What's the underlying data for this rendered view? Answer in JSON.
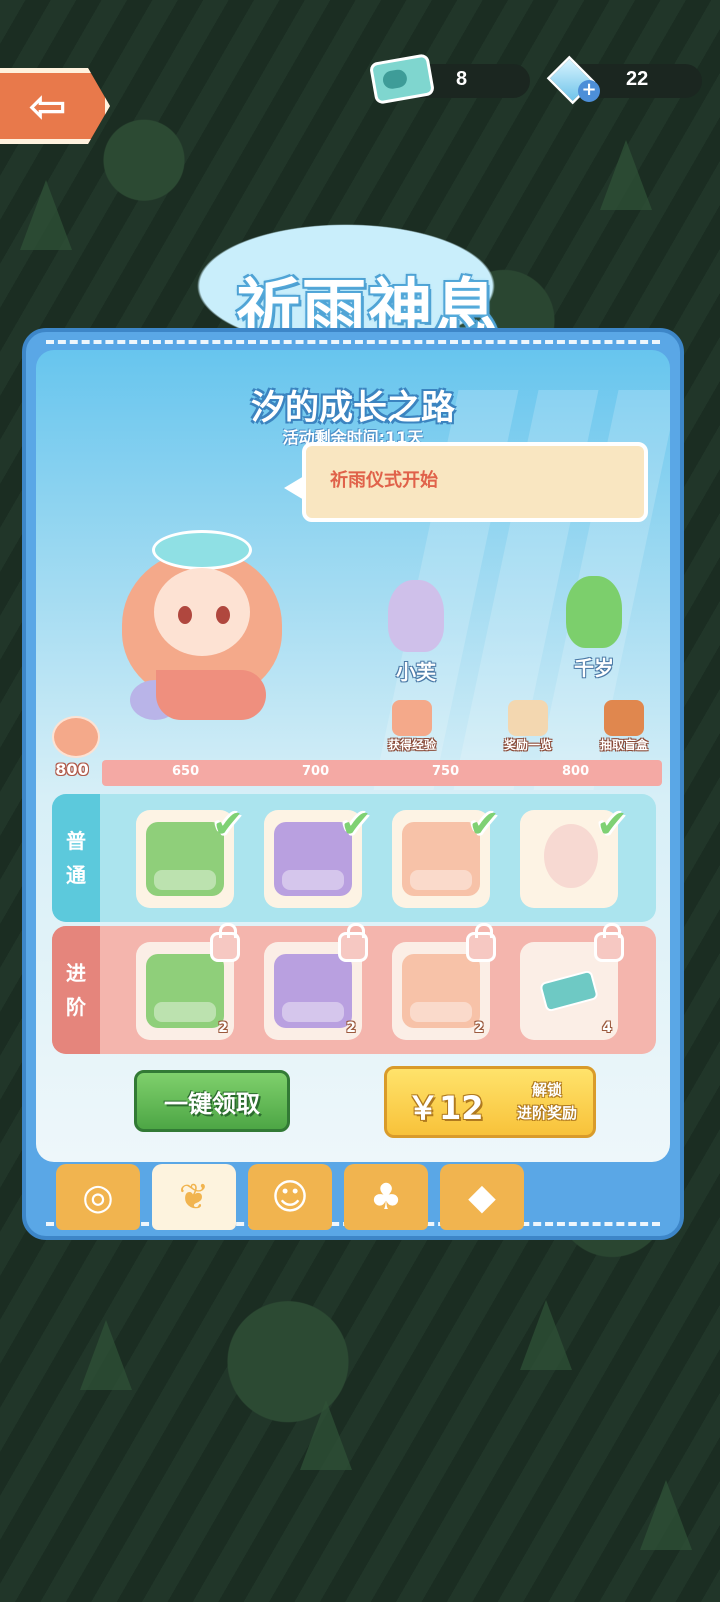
{
  "topbar": {
    "tickets": "8",
    "diamonds": "22"
  },
  "logo": {
    "title": "祈雨神息"
  },
  "panel": {
    "subtitle": "汐的成长之路",
    "time_left": "活动剩余时间:11天",
    "bubble_text": "祈雨仪式开始"
  },
  "characters": [
    {
      "name": "小芙",
      "color": "#cfc0ea"
    },
    {
      "name": "千岁",
      "color": "#7ccf6c"
    }
  ],
  "actions": [
    {
      "label": "获得经验",
      "icon": "exp-up-icon",
      "color": "#f4a98a"
    },
    {
      "label": "奖励一览",
      "icon": "reward-list-icon",
      "color": "#f3d7b0"
    },
    {
      "label": "抽取盲盒",
      "icon": "blind-box-icon",
      "color": "#e0874e"
    }
  ],
  "level": {
    "current": "800",
    "marks": [
      "650",
      "700",
      "750",
      "800"
    ]
  },
  "rows": {
    "normal_label": [
      "普",
      "通"
    ],
    "advanced_label": [
      "进",
      "阶"
    ]
  },
  "normal_rewards": [
    {
      "kind": "gift-box",
      "color": "#8fcf7a",
      "claimed": true
    },
    {
      "kind": "gift-box",
      "color": "#b9a0e0",
      "claimed": true
    },
    {
      "kind": "gift-box",
      "color": "#f7c2a8",
      "claimed": true
    },
    {
      "kind": "egg",
      "color": "#f7d9d2",
      "claimed": true
    }
  ],
  "advanced_rewards": [
    {
      "kind": "gift-box",
      "color": "#8fcf7a",
      "qty": "2",
      "locked": true
    },
    {
      "kind": "gift-box",
      "color": "#b9a0e0",
      "qty": "2",
      "locked": true
    },
    {
      "kind": "gift-box",
      "color": "#f7c2a8",
      "qty": "2",
      "locked": true
    },
    {
      "kind": "ticket",
      "color": "#6ec9c4",
      "qty": "4",
      "locked": true
    }
  ],
  "buttons": {
    "claim_all": "一键领取",
    "price": "￥12",
    "unlock_line1": "解锁",
    "unlock_line2": "进阶奖励"
  },
  "tabs": [
    {
      "icon": "swirl-icon",
      "glyph": "◎"
    },
    {
      "icon": "leaf-icon",
      "glyph": "❦"
    },
    {
      "icon": "friends-icon",
      "glyph": "☺"
    },
    {
      "icon": "tree-icon",
      "glyph": "♣"
    },
    {
      "icon": "cat-icon",
      "glyph": "◆"
    }
  ]
}
